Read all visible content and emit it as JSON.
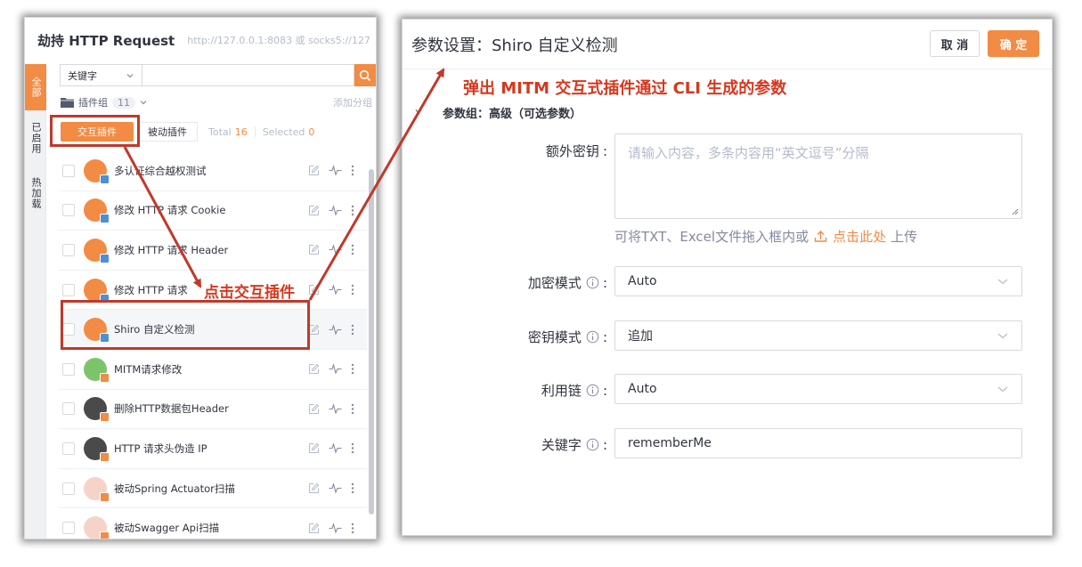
{
  "left": {
    "title": "劫持 HTTP Request",
    "subtitle": "http://127.0.0.1:8083 或 socks5://127",
    "side_tabs": [
      "全部",
      "已启用",
      "热加载"
    ],
    "search": {
      "selected": "关键字",
      "value": ""
    },
    "group": {
      "label": "插件组",
      "count": "11",
      "add": "添加分组"
    },
    "filters": {
      "interactive": "交互插件",
      "passive": "被动插件",
      "total_label": "Total",
      "total_value": "16",
      "selected_label": "Selected",
      "selected_value": "0"
    },
    "plugins": [
      {
        "name": "多认证综合越权测试",
        "avatar": "orange"
      },
      {
        "name": "修改 HTTP 请求 Cookie",
        "avatar": "orange"
      },
      {
        "name": "修改 HTTP 请求 Header",
        "avatar": "orange"
      },
      {
        "name": "修改 HTTP 请求",
        "avatar": "orange"
      },
      {
        "name": "Shiro 自定义检测",
        "avatar": "orange"
      },
      {
        "name": "MITM请求修改",
        "avatar": "frog"
      },
      {
        "name": "删除HTTP数据包Header",
        "avatar": "dark"
      },
      {
        "name": "HTTP 请求头伪造 IP",
        "avatar": "dark"
      },
      {
        "name": "被动Spring Actuator扫描",
        "avatar": "pink"
      },
      {
        "name": "被动Swagger Api扫描",
        "avatar": "pink"
      }
    ]
  },
  "right": {
    "title": "参数设置：Shiro 自定义检测",
    "cancel": "取 消",
    "ok": "确 定",
    "group_title": "参数组：高级（可选参数）",
    "fields": {
      "extra_key": {
        "label": "额外密钥",
        "placeholder": "请输入内容，多条内容用“英文逗号”分隔"
      },
      "help": {
        "text": "可将TXT、Excel文件拖入框内或",
        "link": "点击此处",
        "suffix": "上传"
      },
      "encrypt_mode": {
        "label": "加密模式",
        "value": "Auto"
      },
      "key_mode": {
        "label": "密钥模式",
        "value": "追加"
      },
      "gadget": {
        "label": "利用链",
        "value": "Auto"
      },
      "keyword": {
        "label": "关键字",
        "value": "rememberMe"
      }
    }
  },
  "annotations": {
    "click_plugin": "点击交互插件",
    "popup": "弹出 MITM 交互式插件通过 CLI 生成的参数"
  },
  "colors": {
    "accent": "#f28b44",
    "annotation": "#d6381e"
  }
}
